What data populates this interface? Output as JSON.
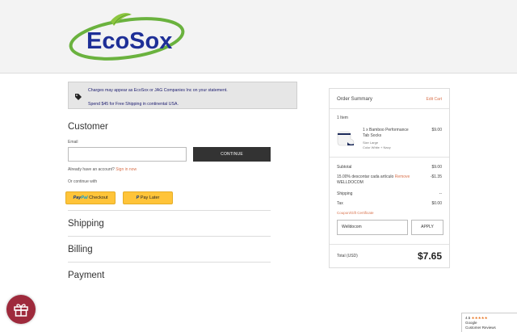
{
  "brand": {
    "logo_text": "EcoSox",
    "colors": {
      "blue": "#1e2f97",
      "green": "#6ab23e",
      "leaf": "#8cc63f"
    }
  },
  "notice": {
    "icon": "tag-icon",
    "line1": "Charges may appear as EcoSox or JAG Companies Inc on your statement.",
    "line2": "Spend $45 for Free Shipping in continental USA."
  },
  "customer": {
    "title": "Customer",
    "email_label": "Email",
    "email_value": "",
    "continue_label": "CONTINUE",
    "account_prompt": "Already have an account?",
    "signin_label": "Sign in now",
    "or_continue": "Or continue with",
    "paypal_part1": "Pay",
    "paypal_part2": "Pal",
    "paypal_checkout": "Checkout",
    "paylater_label": "Pay Later"
  },
  "sections": {
    "shipping": "Shipping",
    "billing": "Billing",
    "payment": "Payment"
  },
  "summary": {
    "title": "Order Summary",
    "edit_cart": "Edit Cart",
    "item_count": "1 Item",
    "item": {
      "name_line1": "1 x Bamboo Performance",
      "name_line2": "Tab Socks",
      "size": "Size Large",
      "color": "Color White + Navy",
      "price": "$9.00"
    },
    "subtotal_label": "Subtotal",
    "subtotal_value": "$9.00",
    "discount_label": "15.00% descontar cada artículo",
    "discount_remove": "Remove",
    "discount_code": "WELLDOCOM",
    "discount_value": "-$1.35",
    "shipping_label": "Shipping",
    "shipping_value": "--",
    "tax_label": "Tax",
    "tax_value": "$0.00",
    "coupon_link": "Coupon/Gift Certificate",
    "coupon_value": "Welldocom",
    "apply_label": "APPLY",
    "total_label": "Total (USD)",
    "total_value": "$7.65"
  },
  "widgets": {
    "gift_icon": "gift-icon",
    "reviews_rating": "4.5",
    "reviews_stars": "★★★★★",
    "reviews_line2": "Google",
    "reviews_line3": "Customer Reviews"
  }
}
